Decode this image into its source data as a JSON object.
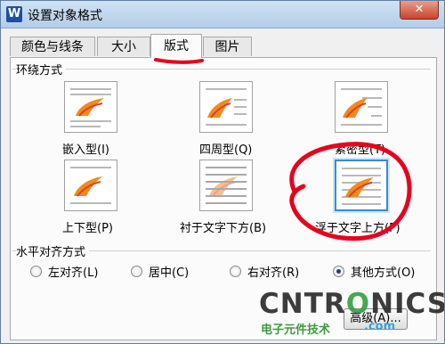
{
  "window": {
    "title": "设置对象格式",
    "app_icon": "W",
    "close_icon": "close-icon",
    "close_glyph": "✕"
  },
  "tabs": [
    {
      "label": "颜色与线条",
      "active": false
    },
    {
      "label": "大小",
      "active": false
    },
    {
      "label": "版式",
      "active": true
    },
    {
      "label": "图片",
      "active": false
    }
  ],
  "wrap_section": {
    "label": "环绕方式",
    "options": [
      {
        "label": "嵌入型(I)",
        "icon": "inline-wrap-icon",
        "selected": false
      },
      {
        "label": "四周型(Q)",
        "icon": "square-wrap-icon",
        "selected": false
      },
      {
        "label": "紧密型(T)",
        "icon": "tight-wrap-icon",
        "selected": false
      },
      {
        "label": "上下型(P)",
        "icon": "top-bottom-wrap-icon",
        "selected": false
      },
      {
        "label": "衬于文字下方(B)",
        "icon": "behind-text-icon",
        "selected": false
      },
      {
        "label": "浮于文字上方(F)",
        "icon": "in-front-of-text-icon",
        "selected": true
      }
    ]
  },
  "align_section": {
    "label": "水平对齐方式",
    "options": [
      {
        "label": "左对齐(L)",
        "checked": false
      },
      {
        "label": "居中(C)",
        "checked": false
      },
      {
        "label": "右对齐(R)",
        "checked": false
      },
      {
        "label": "其他方式(O)",
        "checked": true
      }
    ]
  },
  "advanced_button": {
    "label": "高级(A)..."
  },
  "annotations": {
    "color": "#e8001c"
  },
  "watermark": {
    "brand_prefix": "CNTR",
    "brand_o": "O",
    "brand_suffix": "NICS",
    "subtitle": "电子元件技术",
    "domain": ".com"
  }
}
